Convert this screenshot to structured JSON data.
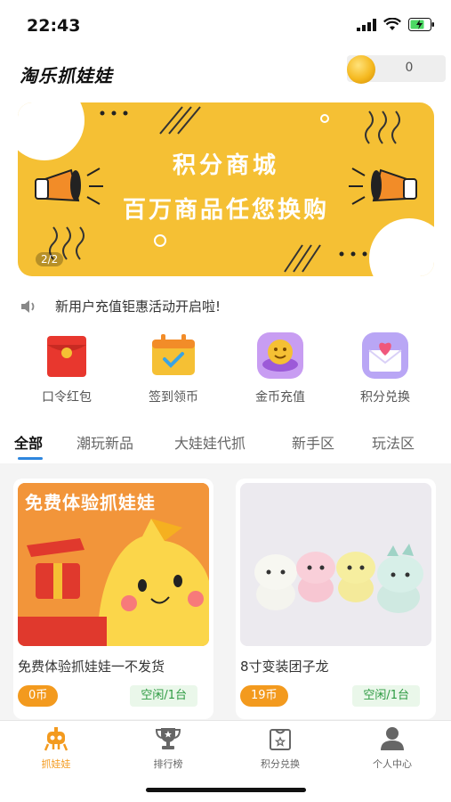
{
  "status_bar": {
    "time": "22:43"
  },
  "header": {
    "app_title": "淘乐抓娃娃",
    "coin_count": "0"
  },
  "banner": {
    "title": "积分商城",
    "subtitle": "百万商品任您换购",
    "page_indicator": "2/2"
  },
  "notice": {
    "text": "新用户充值钜惠活动开启啦!"
  },
  "quick_menu": [
    {
      "label": "口令红包",
      "icon": "red-envelope-icon"
    },
    {
      "label": "签到领币",
      "icon": "calendar-checkin-icon"
    },
    {
      "label": "金币充值",
      "icon": "coin-recharge-icon"
    },
    {
      "label": "积分兑换",
      "icon": "heart-envelope-icon"
    }
  ],
  "tabs": [
    "全部",
    "潮玩新品",
    "大娃娃代抓",
    "新手区",
    "玩法区"
  ],
  "cards": [
    {
      "banner_text": "免费体验抓娃娃",
      "name": "免费体验抓娃娃一不发货",
      "price": "0币",
      "status": "空闲/1台"
    },
    {
      "name": "8寸变装团子龙",
      "price": "19币",
      "status": "空闲/1台"
    }
  ],
  "tabbar": [
    {
      "label": "抓娃娃",
      "icon": "claw-robot-icon"
    },
    {
      "label": "排行榜",
      "icon": "trophy-icon"
    },
    {
      "label": "积分兑换",
      "icon": "shopping-bag-icon"
    },
    {
      "label": "个人中心",
      "icon": "user-icon"
    }
  ],
  "colors": {
    "accent": "#f39a1e",
    "tab_underline": "#2e86de",
    "banner": "#f5c034",
    "status_green": "#2e9b43"
  }
}
